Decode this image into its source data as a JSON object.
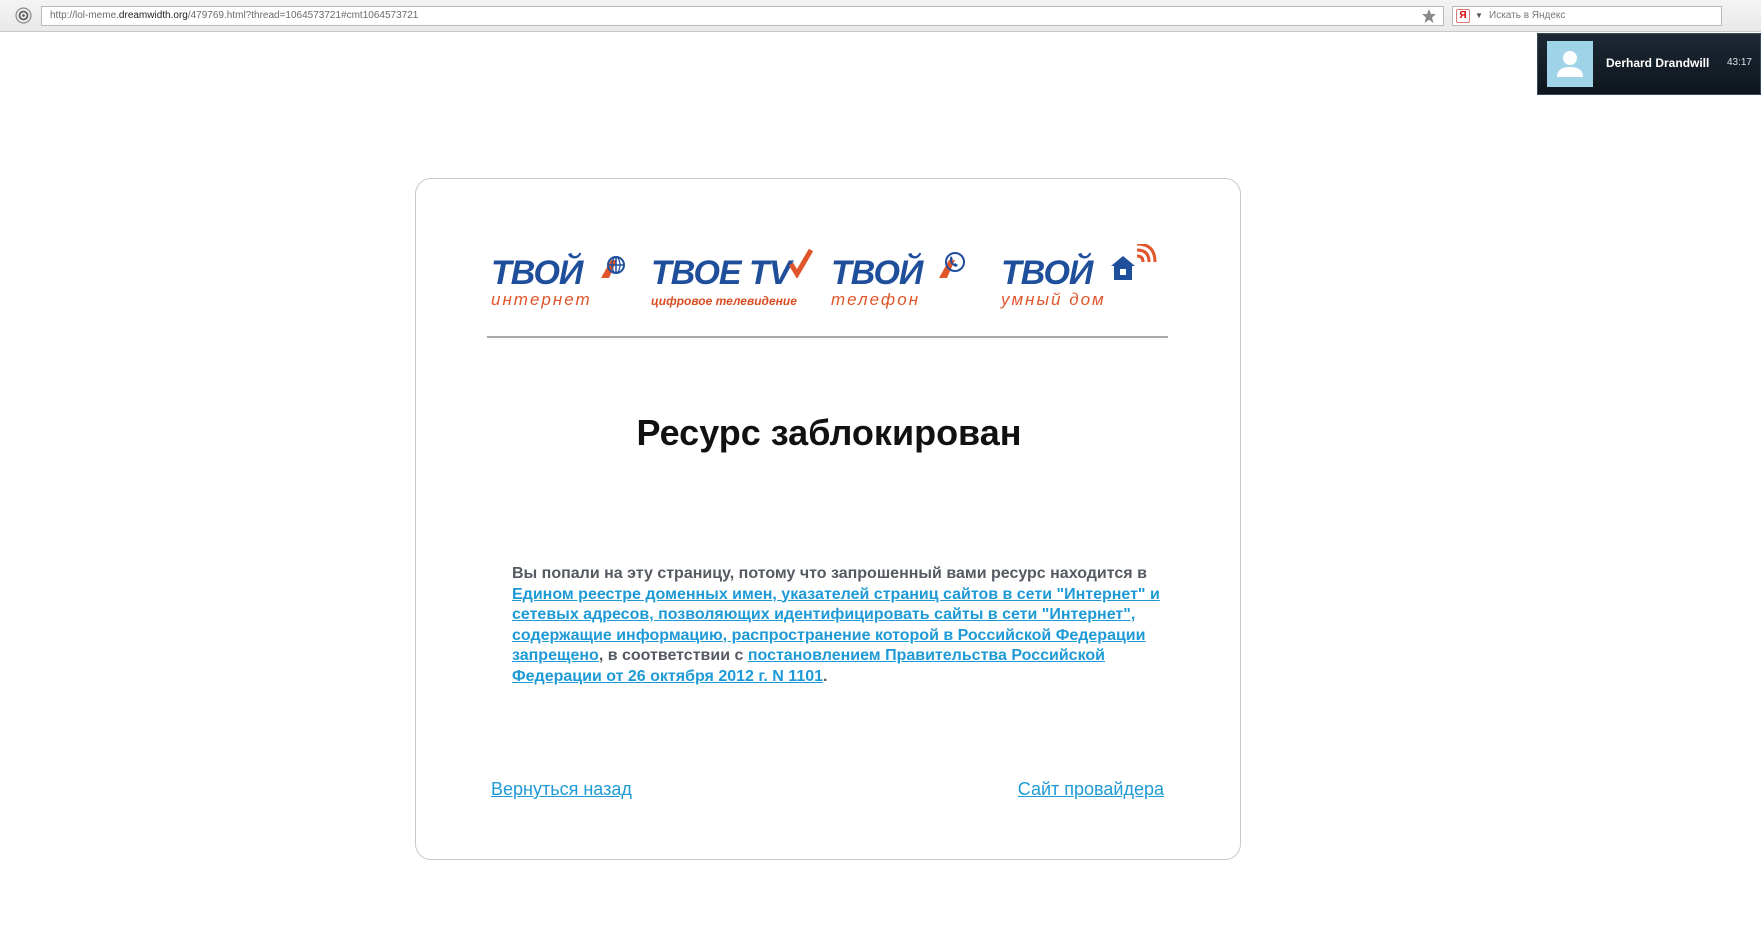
{
  "browser": {
    "url_prefix": "http://lol-meme.",
    "url_domain": "dreamwidth.org",
    "url_rest": "/479769.html?thread=1064573721#cmt1064573721",
    "search_engine_icon": "Я",
    "search_placeholder": "Искать в Яндекс"
  },
  "notification": {
    "name": "Derhard Drandwill",
    "time": "43:17"
  },
  "logos": [
    {
      "brand": "ТВОЙ",
      "sub": "интернет"
    },
    {
      "brand": "ТВОЕ TV",
      "sub": "цифровое телевидение"
    },
    {
      "brand": "ТВОЙ",
      "sub": "телефон"
    },
    {
      "brand": "ТВОЙ",
      "sub": "умный дом"
    }
  ],
  "page": {
    "title": "Ресурс заблокирован",
    "message_intro": "Вы попали на эту страницу, потому что запрошенный вами ресурс находится в ",
    "message_link1": "Едином реестре доменных имен, указателей страниц сайтов в сети \"Интернет\" и сетевых адресов, позволяющих идентифицировать сайты в сети \"Интернет\", содержащие информацию, распространение которой в Российской Федерации запрещено",
    "message_middle": ", в соответствии с ",
    "message_link2": "постановлением Правительства Российской Федерации от 26 октября 2012 г. N 1101",
    "message_end": ".",
    "back_link": "Вернуться назад",
    "provider_link": "Сайт провайдера"
  },
  "colors": {
    "link": "#1e9ad6",
    "brand_blue": "#1f4e9b",
    "brand_orange": "#e0562a"
  }
}
